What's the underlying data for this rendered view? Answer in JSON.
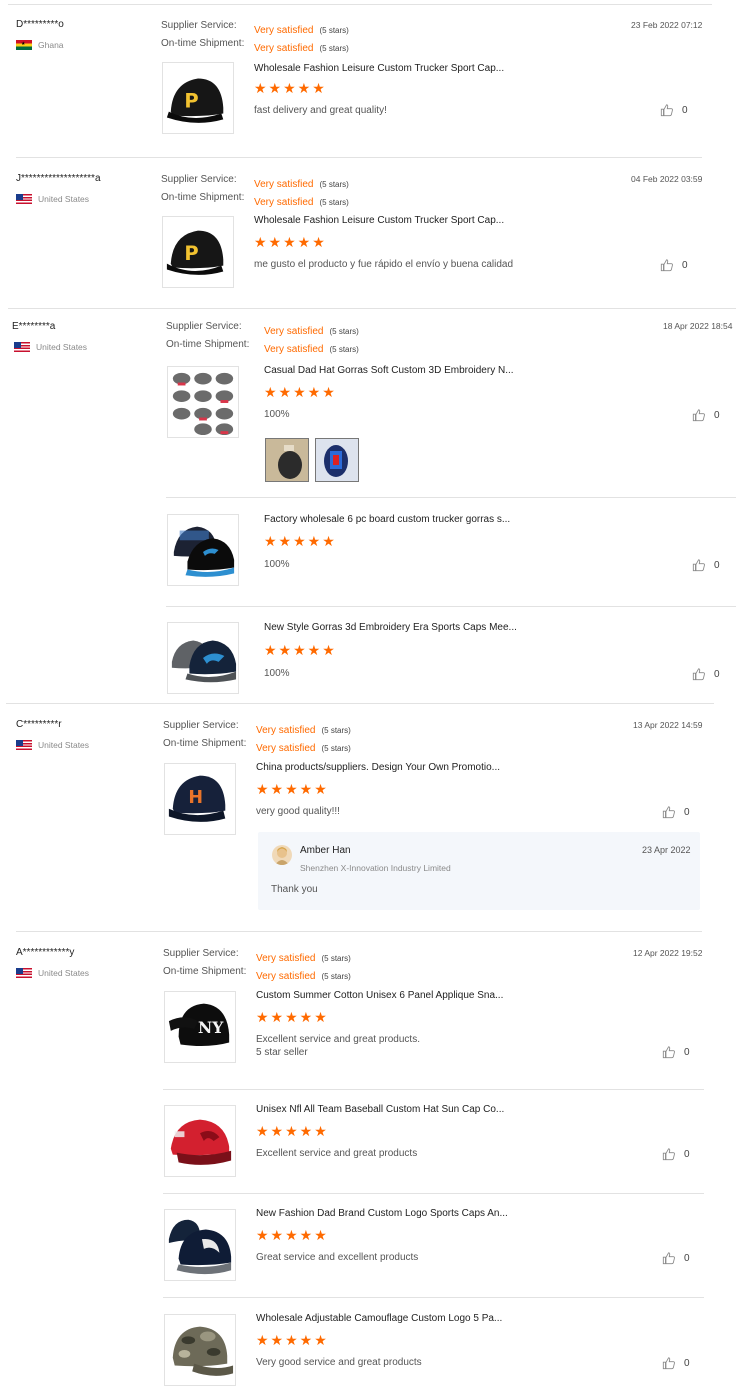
{
  "labels": {
    "supplier_service": "Supplier Service:",
    "on_time_shipment": "On-time Shipment:"
  },
  "colors": {
    "accent": "#ff6a00",
    "divider": "#e2e2e2",
    "reply_bg": "#f4f7fb"
  },
  "reviews": [
    {
      "name": "D*********o",
      "country": "Ghana",
      "flag": "ghana-flag",
      "date": "23 Feb 2022 07:12",
      "supplier_service": "Very satisfied",
      "supplier_service_stars": "(5 stars)",
      "shipment": "Very satisfied",
      "shipment_stars": "(5 stars)",
      "products": [
        {
          "title": "Wholesale Fashion Leisure Custom Trucker Sport Cap...",
          "rating": 5,
          "stars_text": "★★★★★",
          "comment": "fast delivery and great quality!",
          "likes": "0",
          "image": "black-cap-letter-p"
        }
      ]
    },
    {
      "name": "J*******************a",
      "country": "United States",
      "flag": "us-flag",
      "date": "04 Feb 2022 03:59",
      "supplier_service": "Very satisfied",
      "supplier_service_stars": "(5 stars)",
      "shipment": "Very satisfied",
      "shipment_stars": "(5 stars)",
      "products": [
        {
          "title": "Wholesale Fashion Leisure Custom Trucker Sport Cap...",
          "rating": 5,
          "stars_text": "★★★★★",
          "comment": "me gusto el producto y fue rápido el envío y buena calidad",
          "likes": "0",
          "image": "black-cap-letter-p"
        }
      ]
    },
    {
      "name": "E********a",
      "country": "United States",
      "flag": "us-flag",
      "date": "18 Apr 2022 18:54",
      "supplier_service": "Very satisfied",
      "supplier_service_stars": "(5 stars)",
      "shipment": "Very satisfied",
      "shipment_stars": "(5 stars)",
      "products": [
        {
          "title": "Casual Dad Hat Gorras Soft Custom 3D Embroidery N...",
          "rating": 5,
          "stars_text": "★★★★★",
          "comment": "100%",
          "likes": "0",
          "image": "grey-caps-grid"
        },
        {
          "title": "Factory wholesale 6 pc board custom trucker gorras s...",
          "rating": 5,
          "stars_text": "★★★★★",
          "comment": "100%",
          "likes": "0",
          "image": "panthers-caps"
        },
        {
          "title": "New Style Gorras 3d Embroidery Era Sports Caps Mee...",
          "rating": 5,
          "stars_text": "★★★★★",
          "comment": "100%",
          "likes": "0",
          "image": "grey-panthers-caps"
        }
      ]
    },
    {
      "name": "C*********r",
      "country": "United States",
      "flag": "us-flag",
      "date": "13 Apr 2022 14:59",
      "supplier_service": "Very satisfied",
      "supplier_service_stars": "(5 stars)",
      "shipment": "Very satisfied",
      "shipment_stars": "(5 stars)",
      "products": [
        {
          "title": "China products/suppliers. Design Your Own Promotio...",
          "rating": 5,
          "stars_text": "★★★★★",
          "comment": "very good quality!!!",
          "likes": "0",
          "image": "astros-cap"
        }
      ],
      "reply": {
        "name": "Amber Han",
        "company": "Shenzhen X-Innovation Industry Limited",
        "date": "23 Apr 2022",
        "text": "Thank you"
      }
    },
    {
      "name": "A************y",
      "country": "United States",
      "flag": "us-flag",
      "date": "12 Apr 2022 19:52",
      "supplier_service": "Very satisfied",
      "supplier_service_stars": "(5 stars)",
      "shipment": "Very satisfied",
      "shipment_stars": "(5 stars)",
      "products": [
        {
          "title": "Custom Summer Cotton Unisex 6 Panel Applique Sna...",
          "rating": 5,
          "stars_text": "★★★★★",
          "comment": "Excellent service and great products.",
          "comment2": "5 star seller",
          "likes": "0",
          "image": "ny-cap"
        },
        {
          "title": "Unisex Nfl All Team Baseball Custom Hat Sun Cap Co...",
          "rating": 5,
          "stars_text": "★★★★★",
          "comment": "Excellent service and great products",
          "likes": "0",
          "image": "red-cardinals-cap"
        },
        {
          "title": "New Fashion Dad Brand Custom Logo Sports Caps An...",
          "rating": 5,
          "stars_text": "★★★★★",
          "comment": "Great service and excellent products",
          "likes": "0",
          "image": "rams-cap"
        },
        {
          "title": "Wholesale Adjustable Camouflage Custom Logo 5 Pa...",
          "rating": 5,
          "stars_text": "★★★★★",
          "comment": "Very good service and great products",
          "likes": "0",
          "image": "camo-cap"
        }
      ]
    }
  ]
}
